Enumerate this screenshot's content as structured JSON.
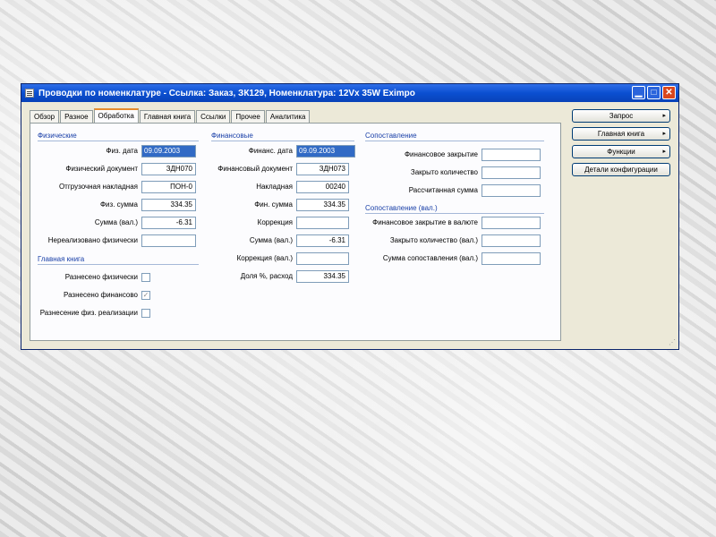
{
  "window": {
    "title": "Проводки по номенклатуре - Ссылка: Заказ, ЗК129, Номенклатура: 12Vx 35W Eximpo",
    "minimize": "▁",
    "maximize": "□",
    "close": "✕"
  },
  "tabs": [
    "Обзор",
    "Разное",
    "Обработка",
    "Главная книга",
    "Ссылки",
    "Прочее",
    "Аналитика"
  ],
  "sections": {
    "physical": "Физические",
    "financial": "Финансовые",
    "matching": "Сопоставление",
    "matching_cur": "Сопоставление (вал.)",
    "ledger": "Главная книга"
  },
  "physical": {
    "date_label": "Физ. дата",
    "date_value": "09.09.2003",
    "doc_label": "Физический документ",
    "doc_value": "ЗДН070",
    "packing_label": "Отгрузочная накладная",
    "packing_value": "ПОН-0",
    "amount_label": "Физ. сумма",
    "amount_value": "334.35",
    "amount_cur_label": "Сумма (вал.)",
    "amount_cur_value": "-6.31",
    "unrealized_label": "Нереализовано физически",
    "unrealized_value": ""
  },
  "financial": {
    "date_label": "Финанс. дата",
    "date_value": "09.09.2003",
    "doc_label": "Финансовый документ",
    "doc_value": "ЗДН073",
    "invoice_label": "Накладная",
    "invoice_value": "00240",
    "amount_label": "Фин. сумма",
    "amount_value": "334.35",
    "correction_label": "Коррекция",
    "correction_value": "",
    "amount_cur_label": "Сумма (вал.)",
    "amount_cur_value": "-6.31",
    "correction_cur_label": "Коррекция (вал.)",
    "correction_cur_value": "",
    "share_label": "Доля %, расход",
    "share_value": "334.35"
  },
  "matching": {
    "fin_closing_label": "Финансовое закрытие",
    "fin_closing_value": "",
    "closed_qty_label": "Закрыто количество",
    "closed_qty_value": "",
    "calc_amount_label": "Рассчитанная сумма",
    "calc_amount_value": ""
  },
  "matching_cur": {
    "fin_closing_cur_label": "Финансовое закрытие в валюте",
    "fin_closing_cur_value": "",
    "closed_qty_cur_label": "Закрыто количество (вал.)",
    "closed_qty_cur_value": "",
    "match_amount_cur_label": "Сумма сопоставления (вал.)",
    "match_amount_cur_value": ""
  },
  "ledger": {
    "posted_physical_label": "Разнесено физически",
    "posted_physical_checked": false,
    "posted_financial_label": "Разнесено финансово",
    "posted_financial_checked": true,
    "posted_realization_label": "Разнесение физ. реализации",
    "posted_realization_checked": false,
    "check_mark": "✓"
  },
  "buttons": {
    "inquiry": "Запрос",
    "ledger": "Главная книга",
    "functions": "Функции",
    "details": "Детали конфигурации",
    "arrow": "▸"
  },
  "resize_grip": "⋰"
}
